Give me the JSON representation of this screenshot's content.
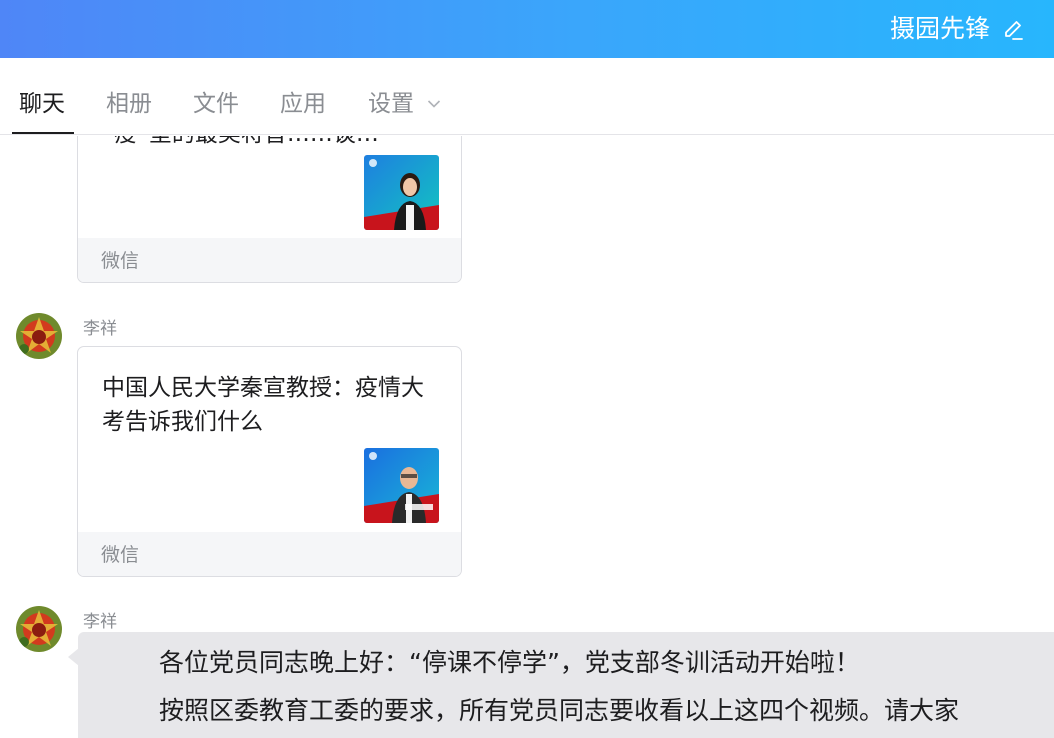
{
  "header": {
    "title": "摄园先锋"
  },
  "tabs": [
    {
      "label": "聊天",
      "active": true
    },
    {
      "label": "相册"
    },
    {
      "label": "文件"
    },
    {
      "label": "应用"
    },
    {
      "label": "设置"
    }
  ],
  "messages": [
    {
      "type": "card",
      "title": "“疫”堂的最美将音……谈…",
      "footer": "微信"
    },
    {
      "type": "card",
      "sender": "李祥",
      "title": "中国人民大学秦宣教授：疫情大考告诉我们什么",
      "footer": "微信"
    },
    {
      "type": "text",
      "sender": "李祥",
      "lines": [
        "各位党员同志晚上好：“停课不停学”，党支部冬训活动开始啦！",
        "按照区委教育工委的要求，所有党员同志要收看以上这四个视频。请大家"
      ]
    }
  ],
  "colors": {
    "header_start": "#4f86f7",
    "header_end": "#27b6fd",
    "bubble": "#e7e7ea"
  }
}
